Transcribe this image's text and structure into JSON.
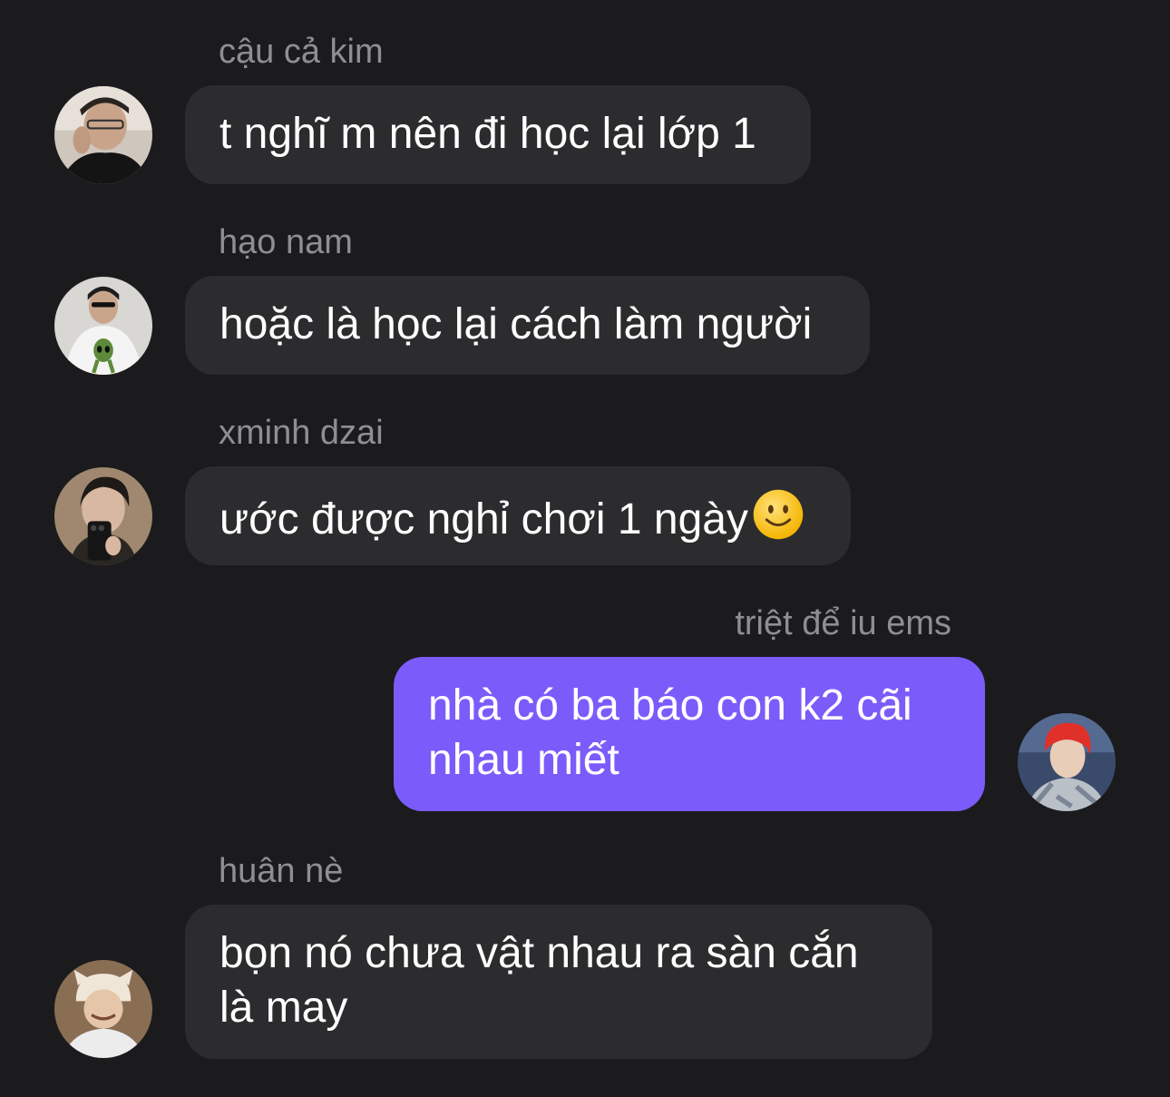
{
  "messages": [
    {
      "sender": "cậu cả kim",
      "text": "t nghĩ m nên đi học lại lớp 1",
      "direction": "incoming",
      "avatar": "avatar-cau-ca-kim"
    },
    {
      "sender": "hạo nam",
      "text": "hoặc là học lại cách làm người",
      "direction": "incoming",
      "avatar": "avatar-hao-nam"
    },
    {
      "sender": "xminh dzai",
      "text": "ước được nghỉ chơi 1 ngày",
      "emoji": "slightly-smiling-face-icon",
      "direction": "incoming",
      "avatar": "avatar-xminh-dzai"
    },
    {
      "sender": "triệt để iu ems",
      "text": "nhà có ba báo con k2 cãi nhau miết",
      "direction": "outgoing",
      "avatar": "avatar-triet-de-iu-ems"
    },
    {
      "sender": "huân nè",
      "text": "bọn nó chưa vật nhau ra sàn cắn là may",
      "direction": "incoming",
      "avatar": "avatar-huan-ne"
    }
  ],
  "colors": {
    "background": "#1b1b1d",
    "incoming_bubble": "#2c2c2e",
    "outgoing_bubble": "#7b5cfa",
    "sender_name": "#8e8e93",
    "message_text": "#ffffff"
  }
}
